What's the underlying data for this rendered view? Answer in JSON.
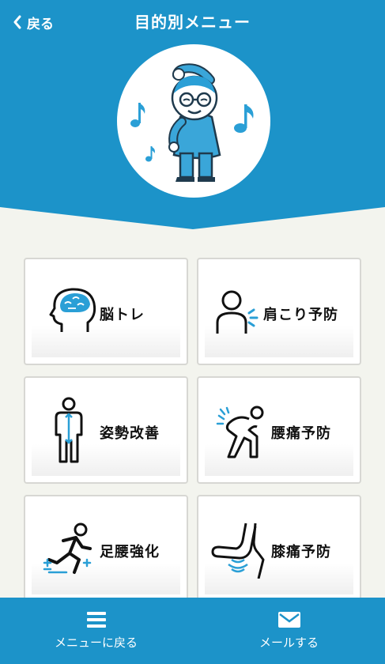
{
  "header": {
    "back_label": "戻る",
    "title": "目的別メニュー"
  },
  "menu": [
    {
      "label": "脳トレ",
      "icon": "brain-head-icon"
    },
    {
      "label": "肩こり予防",
      "icon": "shoulder-icon"
    },
    {
      "label": "姿勢改善",
      "icon": "posture-icon"
    },
    {
      "label": "腰痛予防",
      "icon": "back-pain-icon"
    },
    {
      "label": "足腰強化",
      "icon": "running-icon"
    },
    {
      "label": "膝痛予防",
      "icon": "knee-icon"
    }
  ],
  "bottom_bar": {
    "menu_label": "メニューに戻る",
    "mail_label": "メールする"
  },
  "colors": {
    "primary": "#1c93c9",
    "background": "#f3f4ee",
    "accent_icon": "#2a9fd6"
  }
}
